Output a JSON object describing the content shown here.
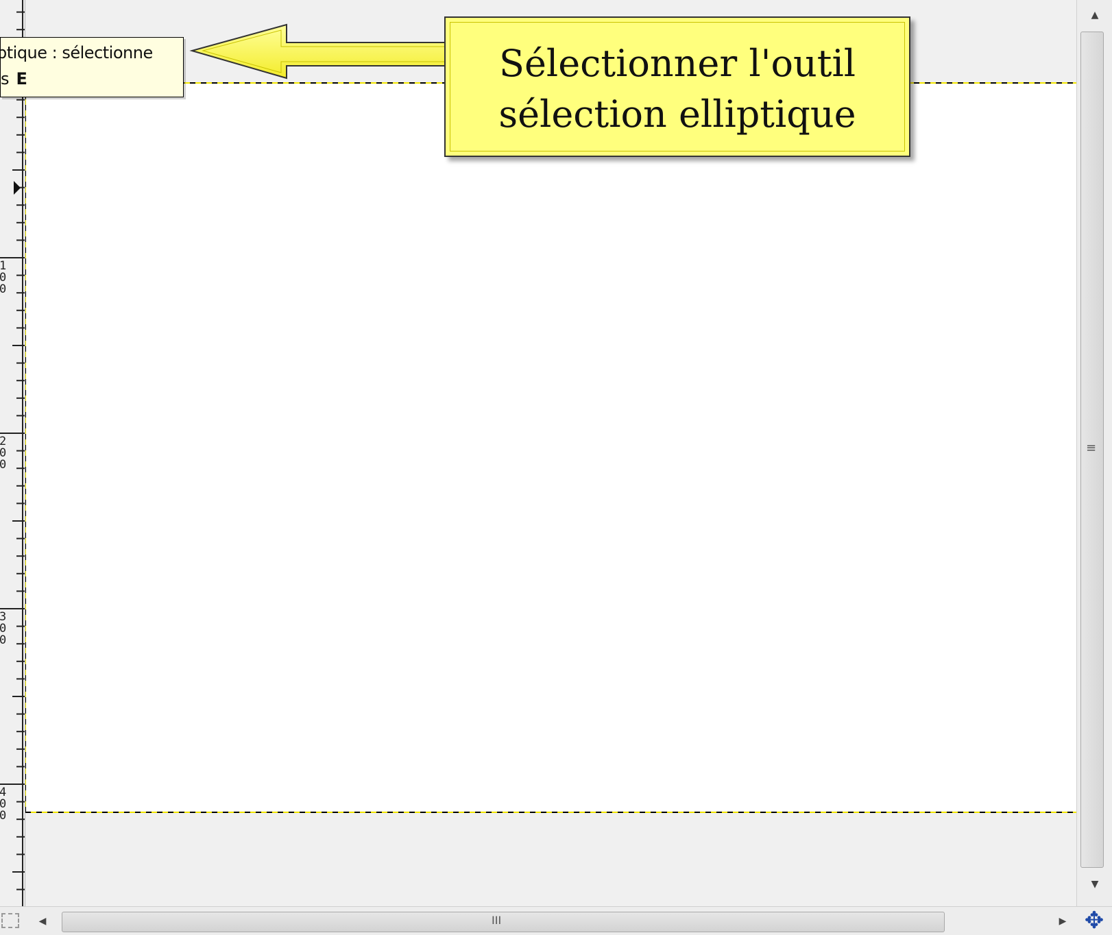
{
  "ruler": {
    "labels": [
      "1\n0\n0",
      "2\n0\n0",
      "3\n0\n0",
      "4\n0\n0"
    ]
  },
  "tooltip": {
    "line1": "ptique : sélectionne",
    "line2_prefix": "s",
    "shortcut_key": "E"
  },
  "callout": {
    "line1": "Sélectionner l'outil",
    "line2": "sélection elliptique"
  },
  "scrollbars": {
    "up_arrow": "▲",
    "down_arrow": "▼",
    "left_arrow": "◀",
    "right_arrow": "▶",
    "vgrip": "≡",
    "hgrip": "III"
  },
  "icons": {
    "navigate": "navigate-icon",
    "quick_mask": "quick-mask-toggle-icon"
  },
  "colors": {
    "callout_fill": "#ffff7d",
    "tooltip_fill": "#fffee0",
    "selection_dash": "#f2e600",
    "nav_icon": "#1f4aa8"
  }
}
